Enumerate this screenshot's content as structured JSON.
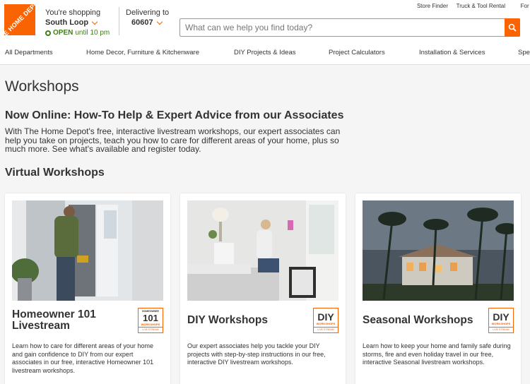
{
  "header": {
    "logo_text": "THE HOME DEPOT",
    "store_label": "You're shopping",
    "store_name": "South Loop",
    "store_status": "OPEN",
    "store_hours": "until 10 pm",
    "deliver_label": "Delivering to",
    "zip": "60607",
    "top_links": [
      "Store Finder",
      "Truck & Tool Rental",
      "For the"
    ],
    "search_placeholder": "What can we help you find today?"
  },
  "nav": {
    "items": [
      "All Departments",
      "Home Decor, Furniture & Kitchenware",
      "DIY Projects & Ideas",
      "Project Calculators",
      "Installation & Services",
      "Spe"
    ]
  },
  "main": {
    "page_title": "Workshops",
    "heading": "Now Online: How-To Help & Expert Advice from our Associates",
    "intro": "With The Home Depot's free, interactive livestream workshops, our expert associates can help you take on projects, teach you how to care for different areas of your home, plus so much more. See what's available and register today.",
    "section_title": "Virtual Workshops"
  },
  "cards": [
    {
      "title": "Homeowner 101 Livestream",
      "badge_top": "101",
      "badge_sub": "HOMEOWNER",
      "badge_mid": "WORKSHOPS",
      "badge_live": "LIVE STREAM",
      "desc": "Learn how to care for different areas of your home and gain confidence to DIY from our expert associates in our free, interactive Homeowner 101 livestream workshops."
    },
    {
      "title": "DIY Workshops",
      "badge_top": "DIY",
      "badge_mid": "WORKSHOPS",
      "badge_live": "LIVE STREAM",
      "desc": "Our expert associates help you tackle your DIY projects with step-by-step instructions in our free, interactive DIY livestream workshops."
    },
    {
      "title": "Seasonal Workshops",
      "badge_top": "DIY",
      "badge_mid": "WORKSHOPS",
      "badge_live": "LIVE STREAM",
      "desc": "Learn how to keep your home and family safe during storms, fire and even holiday travel in our free, interactive Seasonal livestream workshops."
    }
  ],
  "colors": {
    "brand": "#f96302",
    "open_green": "#3e7d17"
  }
}
